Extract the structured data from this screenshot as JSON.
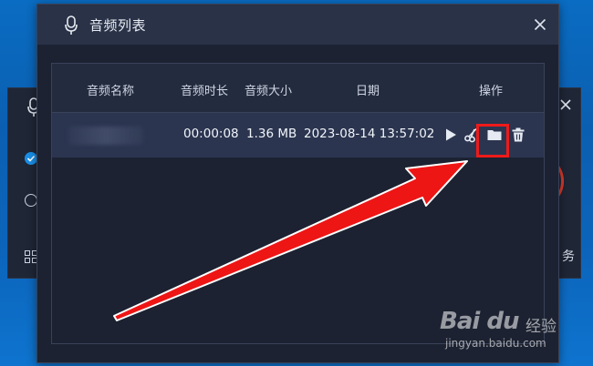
{
  "dialog": {
    "title": "音频列表"
  },
  "table": {
    "columns": [
      "音频名称",
      "音频时长",
      "音频大小",
      "日期",
      "操作"
    ],
    "rows": [
      {
        "name": "",
        "duration": "00:00:08",
        "size": "1.36 MB",
        "date": "2023-08-14 13:57:02"
      }
    ],
    "actions": [
      "play-icon",
      "scissors-icon",
      "folder-icon",
      "trash-icon"
    ]
  },
  "background_window": {
    "side_text": "务"
  },
  "watermark": {
    "brand": "Bai du",
    "cn": "经验",
    "url": "jingyan.baidu.com"
  },
  "colors": {
    "highlight": "#ef1a1a",
    "accent": "#1a8fe8",
    "row_bg": "#2b3550",
    "dialog_bg": "#1c2231"
  }
}
